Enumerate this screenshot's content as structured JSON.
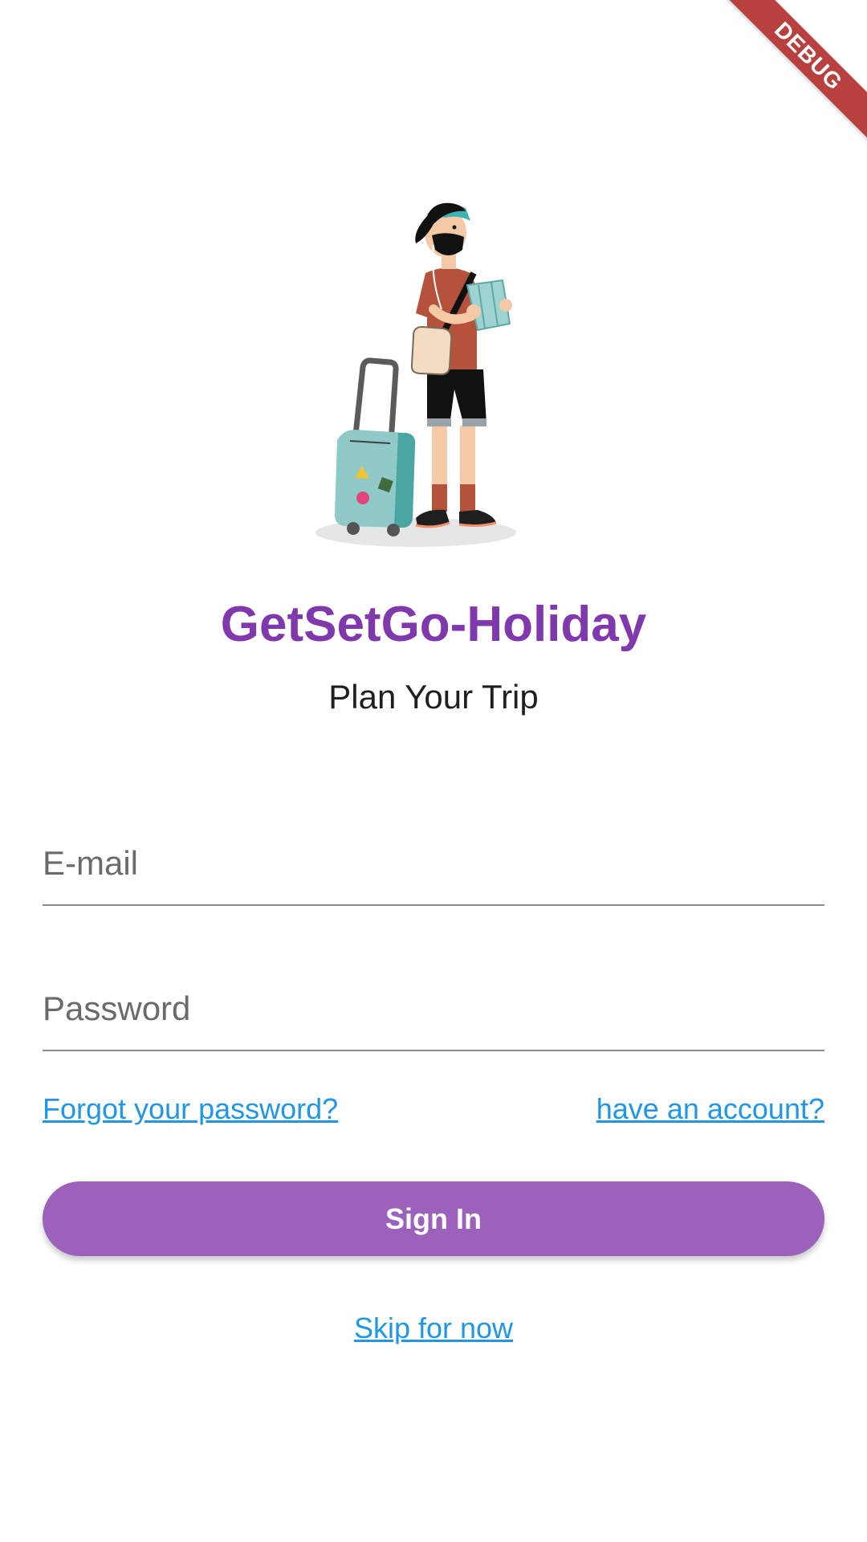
{
  "debug_banner": {
    "label": "DEBUG"
  },
  "illustration": {
    "icon": "traveler-with-suitcase-illustration"
  },
  "header": {
    "title": "GetSetGo-Holiday",
    "subtitle": "Plan Your Trip"
  },
  "form": {
    "email_placeholder": "E-mail",
    "email_value": "",
    "password_placeholder": "Password",
    "password_value": ""
  },
  "links": {
    "forgot_password": "Forgot your password?",
    "have_account": "have an account?",
    "skip": "Skip for now"
  },
  "buttons": {
    "sign_in": "Sign In"
  },
  "colors": {
    "title": "#8038ad",
    "button": "#9c62bb",
    "link": "#2196e6",
    "debug": "#b8413f"
  }
}
